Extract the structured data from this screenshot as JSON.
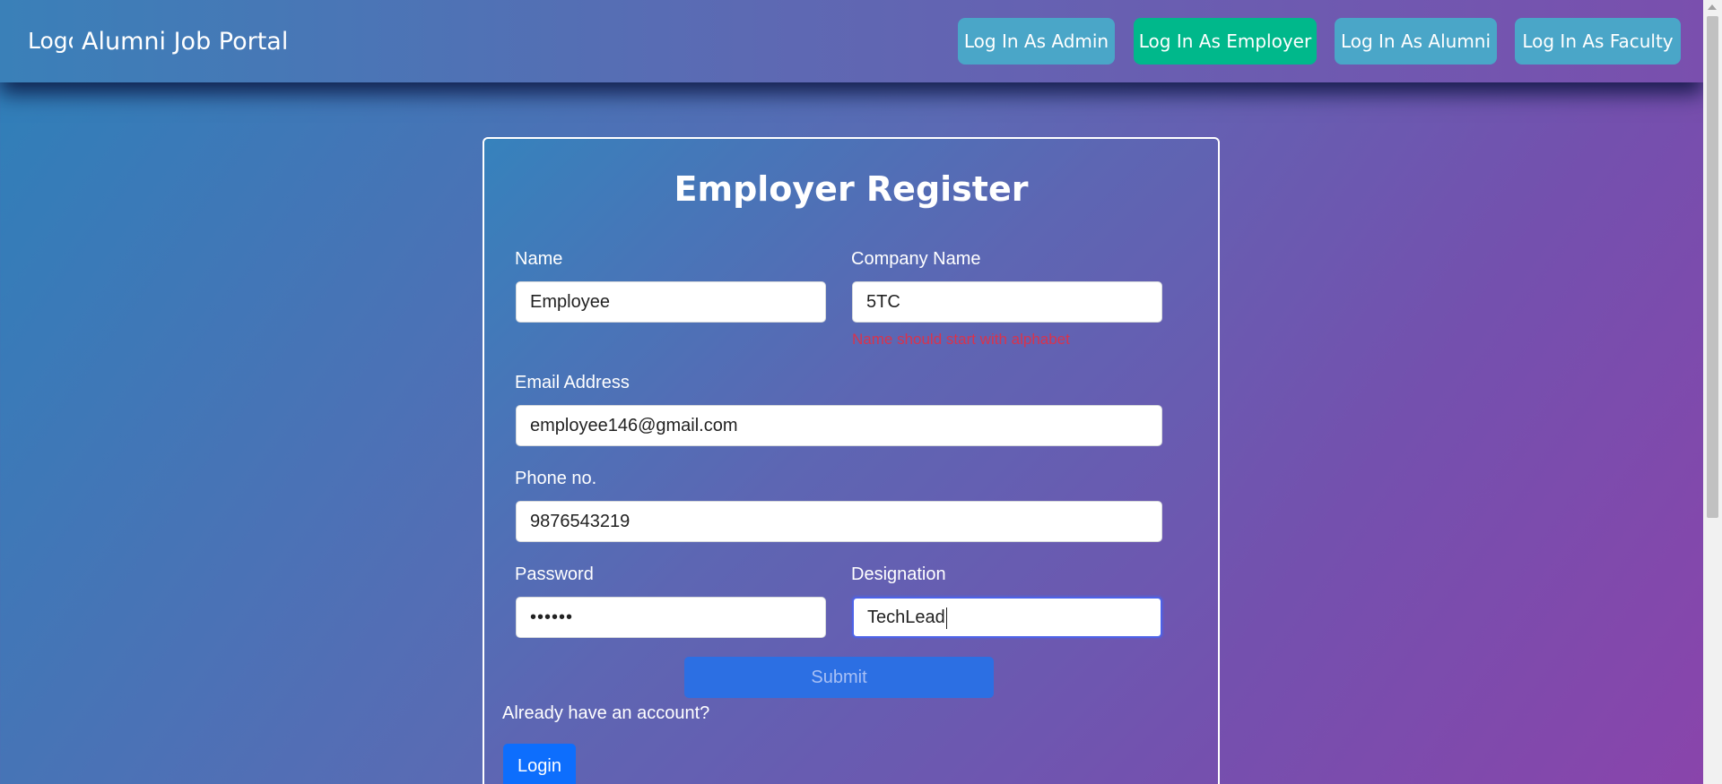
{
  "navbar": {
    "logo_alt": "Logo",
    "brand_title": "Alumni Job Portal",
    "buttons": [
      {
        "label": "Log In As Admin"
      },
      {
        "label": "Log In As Employer"
      },
      {
        "label": "Log In As Alumni"
      },
      {
        "label": "Log In As Faculty"
      }
    ],
    "active_button": "Log In As Employer"
  },
  "form": {
    "title": "Employer Register",
    "name": {
      "label": "Name",
      "value": "Employee"
    },
    "company": {
      "label": "Company Name",
      "value": "5TC",
      "error": "Name should start with alphabet"
    },
    "email": {
      "label": "Email Address",
      "value": "employee146@gmail.com"
    },
    "phone": {
      "label": "Phone no.",
      "value": "9876543219"
    },
    "password": {
      "label": "Password",
      "value": "••••••"
    },
    "designation": {
      "label": "Designation",
      "value": "TechLead"
    },
    "submit_label": "Submit",
    "account_prompt": "Already have an account?",
    "login_label": "Login"
  },
  "colors": {
    "nav_info": "#4aa6c8",
    "nav_active": "#00b88b",
    "error": "#d9334d",
    "submit": "#2c6fe3",
    "login": "#0d6efd"
  }
}
